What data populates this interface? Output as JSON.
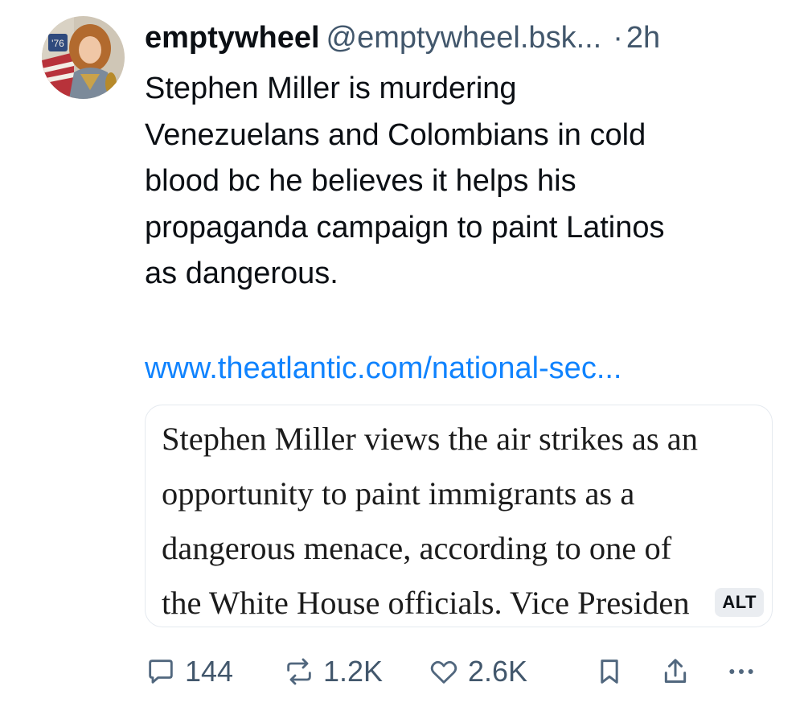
{
  "post": {
    "author": {
      "display_name": "emptywheel",
      "handle": "@emptywheel.bsk...",
      "separator": "·",
      "time": "2h",
      "avatar_badge": "'76"
    },
    "text_lines": [
      "Stephen Miller is murdering",
      "Venezuelans and Colombians in cold",
      "blood bc he believes it helps his",
      "propaganda campaign to paint Latinos",
      "as dangerous."
    ],
    "link_text": "www.theatlantic.com/national-sec...",
    "embed": {
      "image_text_lines": [
        "Stephen Miller views the air strikes as an",
        "opportunity to paint immigrants as a",
        "dangerous menace, according to one of",
        "the White House officials. Vice Presiden"
      ],
      "alt_badge": "ALT"
    },
    "actions": {
      "reply_count": "144",
      "repost_count": "1.2K",
      "like_count": "2.6K",
      "icons": [
        "reply-icon",
        "repost-icon",
        "like-icon",
        "bookmark-icon",
        "share-icon",
        "more-icon"
      ]
    }
  },
  "colors": {
    "link": "#1083fe",
    "muted": "#42576c",
    "text": "#0b0f14",
    "card_border": "#e4e9ef"
  }
}
